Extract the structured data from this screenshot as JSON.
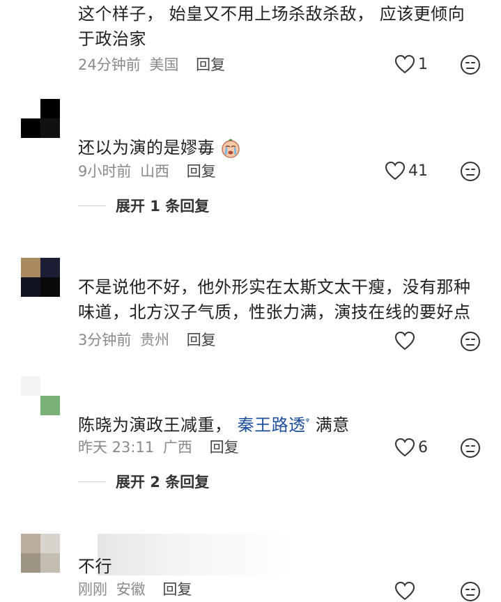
{
  "comments": [
    {
      "text_line1": "这个样子， 始皇又不用上场杀敌杀敌， 应该更倾向",
      "text_line2": "于政治家",
      "time": "24分钟前",
      "location": "美国",
      "reply": "回复",
      "likes": "1"
    },
    {
      "text": "还以为演的是嫪毐",
      "time": "9小时前",
      "location": "山西",
      "reply": "回复",
      "likes": "41",
      "expand": "展开 1 条回复"
    },
    {
      "text_line1": "不是说他不好，他外形实在太斯文太干瘦，没有那种",
      "text_line2": "味道，北方汉子气质，性张力满，演技在线的要好点",
      "time": "3分钟前",
      "location": "贵州",
      "reply": "回复",
      "likes": ""
    },
    {
      "text_before": "陈晓为演政王减重，",
      "mention": "秦王路透",
      "mention_icon": "ᵠ",
      "text_after": "满意",
      "time": "昨天 23:11",
      "location": "广西",
      "reply": "回复",
      "likes": "6",
      "expand": "展开 2 条回复"
    },
    {
      "text": "不行",
      "time": "刚刚",
      "location": "安徽",
      "reply": "回复",
      "likes": ""
    }
  ],
  "colors": {
    "meta": "#8a8a8a",
    "mention": "#1d4f9a"
  }
}
